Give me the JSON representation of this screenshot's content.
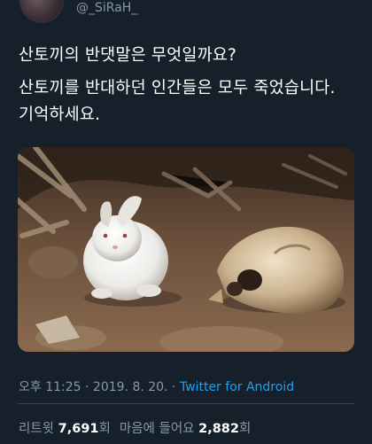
{
  "user": {
    "handle": "@_SiRaH_"
  },
  "tweet": {
    "line1": "산토끼의 반댓말은 무엇일까요?",
    "line2": "산토끼를 반대하던 인간들은 모두 죽었습니다. 기억하세요."
  },
  "meta": {
    "time": "오후 11:25",
    "separator": "·",
    "date": "2019. 8. 20.",
    "source": "Twitter for Android"
  },
  "stats": {
    "retweets_label": "리트윗",
    "retweets_count": "7,691",
    "retweets_unit": "회",
    "likes_label": "마음에 들어요",
    "likes_count": "2,882",
    "likes_unit": "회"
  },
  "colors": {
    "background": "#15202b",
    "muted_text": "#8899a6",
    "link": "#1da1f2"
  }
}
